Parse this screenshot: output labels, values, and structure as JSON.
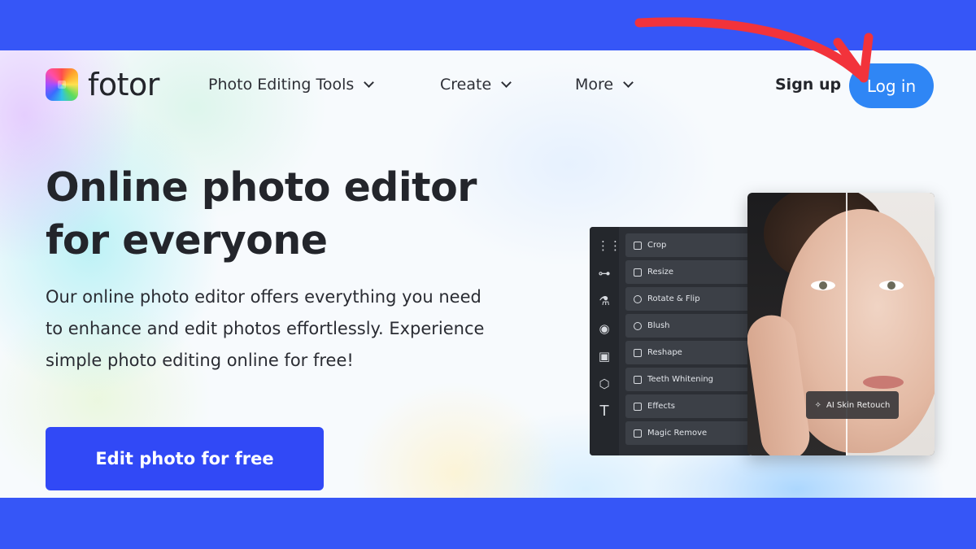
{
  "brand": {
    "name": "fotor"
  },
  "nav": {
    "items": [
      {
        "label": "Photo Editing Tools"
      },
      {
        "label": "Create"
      },
      {
        "label": "More"
      }
    ],
    "signup_label": "Sign up",
    "login_label": "Log in"
  },
  "hero": {
    "headline_line1": "Online photo editor",
    "headline_line2": "for everyone",
    "description": "Our online photo editor offers everything you need to enhance and edit photos effortlessly. Experience simple photo editing online for free!",
    "cta_label": "Edit photo for free"
  },
  "editor": {
    "menu": [
      "Crop",
      "Resize",
      "Rotate & Flip",
      "Blush",
      "Reshape",
      "Teeth Whitening",
      "Effects",
      "Magic Remove"
    ],
    "badge_label": "AI Skin Retouch"
  },
  "colors": {
    "band": "#3656f7",
    "login": "#2f86f5",
    "cta": "#3149f6",
    "annotation_arrow": "#f2333b"
  }
}
